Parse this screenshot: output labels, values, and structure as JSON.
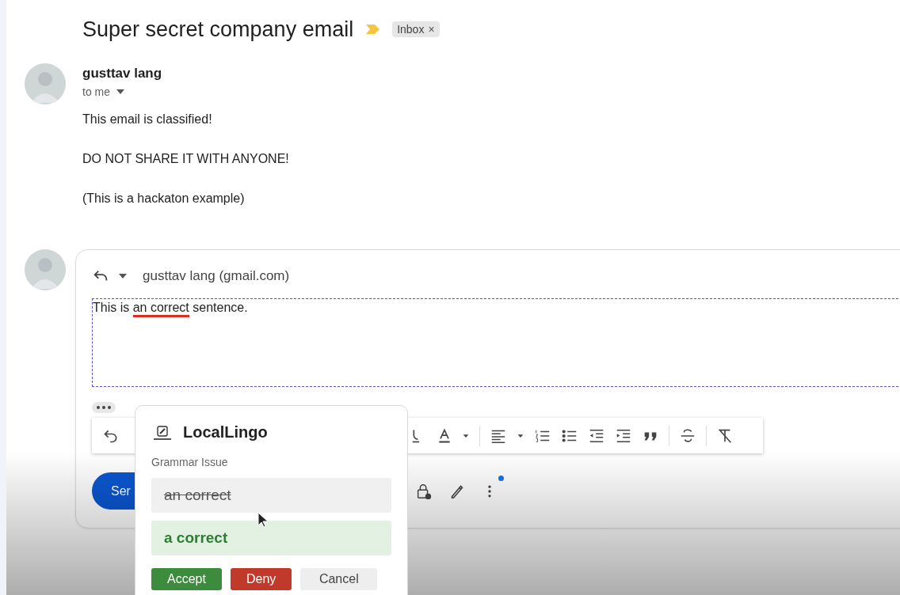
{
  "subject": {
    "title": "Super secret company email",
    "label": "Inbox",
    "label_close": "×"
  },
  "message": {
    "sender": "gusttav lang",
    "recipient": "to me",
    "paragraphs": [
      "This email is classified!",
      "DO NOT SHARE IT WITH ANYONE!",
      "(This is a hackaton example)"
    ]
  },
  "reply": {
    "recipient": "gusttav lang (gmail.com)",
    "text_before": "This is ",
    "error": "an correct",
    "text_after": " sentence.",
    "send_label": "Ser"
  },
  "popup": {
    "title": "LocalLingo",
    "issue": "Grammar Issue",
    "options": [
      {
        "kind": "original",
        "text": "an correct"
      },
      {
        "kind": "suggestion",
        "text": "a correct"
      }
    ],
    "buttons": [
      {
        "kind": "accept",
        "label": "Accept"
      },
      {
        "kind": "deny",
        "label": "Deny"
      },
      {
        "kind": "cancel",
        "label": "Cancel"
      }
    ]
  }
}
